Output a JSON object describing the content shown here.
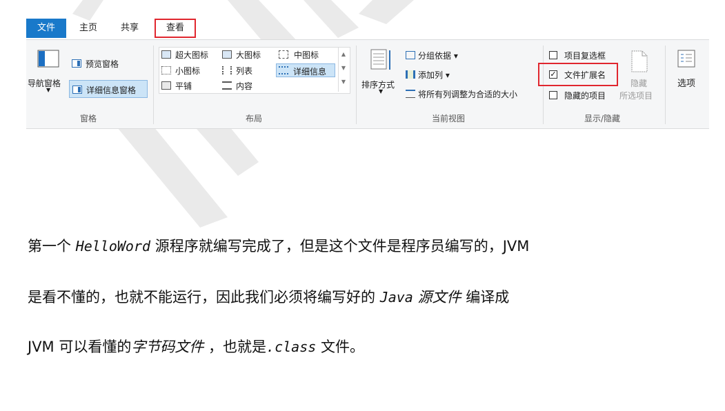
{
  "tabs": {
    "file": "文件",
    "home": "主页",
    "share": "共享",
    "view": "查看"
  },
  "panes": {
    "nav_pane": "导航窗格",
    "preview_pane": "预览窗格",
    "details_pane": "详细信息窗格",
    "group_label": "窗格"
  },
  "layout": {
    "extra_large_icons": "超大图标",
    "large_icons": "大图标",
    "medium_icons": "中图标",
    "small_icons": "小图标",
    "list": "列表",
    "details": "详细信息",
    "tiles": "平铺",
    "content": "内容",
    "group_label": "布局"
  },
  "current_view": {
    "sort_by": "排序方式",
    "group_by": "分组依据 ▾",
    "add_columns": "添加列 ▾",
    "size_all_columns": "将所有列调整为合适的大小",
    "group_label": "当前视图"
  },
  "show_hide": {
    "item_check_boxes": "项目复选框",
    "item_check_boxes_checked": false,
    "file_name_extensions": "文件扩展名",
    "file_name_extensions_checked": true,
    "hidden_items": "隐藏的项目",
    "hidden_items_checked": false,
    "hide": "隐藏",
    "selected_items": "所选项目",
    "group_label": "显示/隐藏"
  },
  "options": {
    "label": "选项"
  },
  "article": {
    "line1_a": "第一个 ",
    "line1_code": "HelloWord",
    "line1_b": " 源程序就编写完成了，但是这个文件是程序员编写的，JVM",
    "line2_a": "是看不懂的，也就不能运行，因此我们必须将编写好的 ",
    "line2_code": "Java",
    "line2_it": " 源文件",
    "line2_b": "  编译成",
    "line3_a": "JVM 可以看懂的",
    "line3_it": "字节码文件",
    "line3_b": " ，也就是",
    "line3_code": ".class",
    "line3_c": " 文件。"
  },
  "colors": {
    "file_tab": "#1979ca",
    "highlight_red": "#e0262e",
    "ribbon_bg": "#f5f6f7",
    "selection_blue": "#cce4f7"
  }
}
